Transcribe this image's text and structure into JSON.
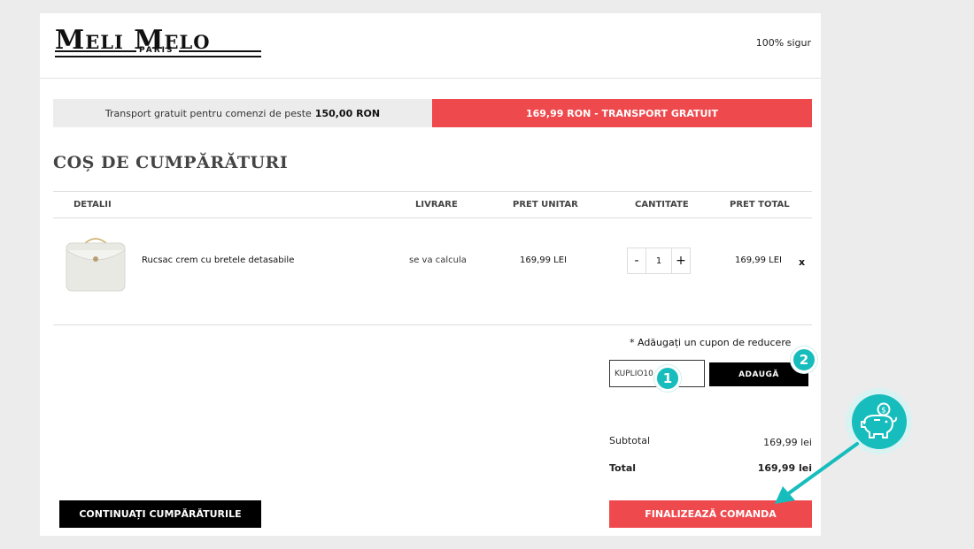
{
  "header": {
    "logo_main": "Meli Melo",
    "logo_sub": "PARIS",
    "safe_text": "100% sigur"
  },
  "shipping": {
    "info_text": "Transport gratuit pentru comenzi de peste",
    "info_amount": "150,00 RON",
    "status_text": "169,99 RON - TRANSPORT GRATUIT"
  },
  "page_title": "COȘ DE CUMPĂRĂTURI",
  "table": {
    "columns": [
      "DETALII",
      "LIVRARE",
      "PRET UNITAR",
      "CANTITATE",
      "PRET TOTAL"
    ],
    "rows": [
      {
        "name": "Rucsac crem cu bretele detasabile",
        "delivery": "se va calcula",
        "unit_price": "169,99 LEI",
        "quantity": "1",
        "qty_minus": "-",
        "qty_plus": "+",
        "total": "169,99 LEI",
        "remove": "x"
      }
    ]
  },
  "coupon": {
    "label": "* Adăugați un cupon de reducere",
    "value": "KUPLIO10",
    "button": "ADAUGĂ"
  },
  "markers": [
    "1",
    "2"
  ],
  "summary": {
    "subtotal_label": "Subtotal",
    "subtotal_value": "169,99 lei",
    "total_label": "Total",
    "total_value": "169,99 lei"
  },
  "buttons": {
    "continue": "CONTINUAȚI CUMPĂRĂTURILE",
    "checkout": "FINALIZEAZĂ COMANDA"
  },
  "colors": {
    "accent_red": "#ee4a4e",
    "teal": "#17bdbd"
  },
  "icons": {
    "piggy": "piggy-bank-icon"
  }
}
